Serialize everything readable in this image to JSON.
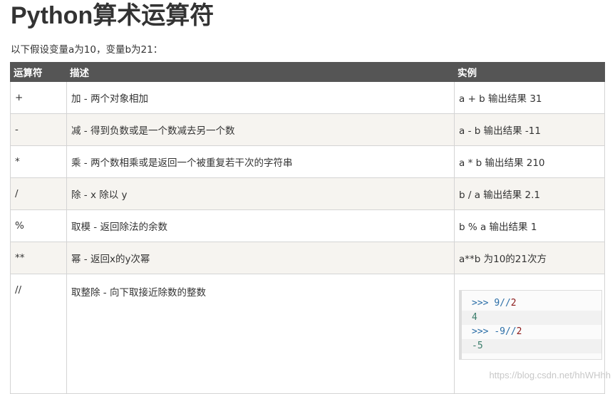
{
  "title": "Python算术运算符",
  "intro": "以下假设变量a为10，变量b为21：",
  "table": {
    "headers": [
      "运算符",
      "描述",
      "实例"
    ],
    "rows": [
      {
        "op": "+",
        "desc": "加 - 两个对象相加",
        "example": "a + b 输出结果 31"
      },
      {
        "op": "-",
        "desc": "减 - 得到负数或是一个数减去另一个数",
        "example": "a - b 输出结果 -11"
      },
      {
        "op": "*",
        "desc": "乘 - 两个数相乘或是返回一个被重复若干次的字符串",
        "example": "a * b 输出结果 210"
      },
      {
        "op": "/",
        "desc": "除 - x 除以 y",
        "example": "b / a 输出结果 2.1"
      },
      {
        "op": "%",
        "desc": "取模 - 返回除法的余数",
        "example": "b % a 输出结果 1"
      },
      {
        "op": "**",
        "desc": "幂 - 返回x的y次幂",
        "example": "a**b 为10的21次方"
      },
      {
        "op": "//",
        "desc": "取整除 - 向下取接近除数的整数",
        "example": ""
      }
    ]
  },
  "code_example": {
    "prompt": ">>>",
    "line1_expr_a": "9//",
    "line1_expr_b": "2",
    "line2": "4",
    "line3_expr_a": "-9//",
    "line3_expr_b": "2",
    "line4": "-5"
  },
  "watermark": "https://blog.csdn.net/hhWHhh"
}
